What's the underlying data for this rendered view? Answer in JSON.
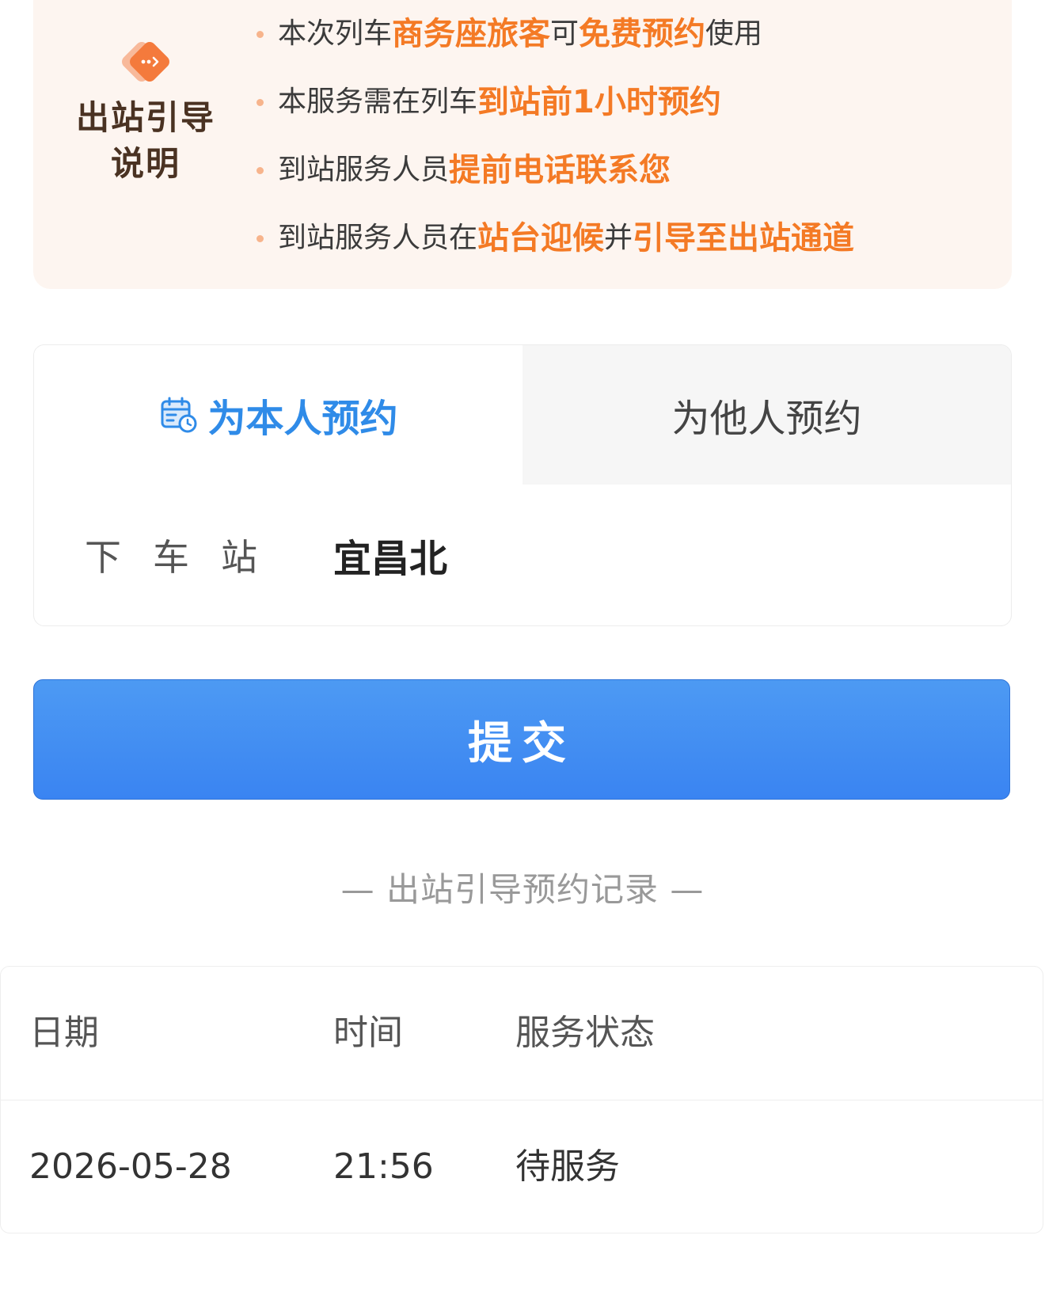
{
  "guide": {
    "title": "出站引导\n说明",
    "items": [
      {
        "parts": [
          "本次列车",
          "商务座旅客",
          "可",
          "免费预约",
          "使用"
        ]
      },
      {
        "parts": [
          "本服务需在列车",
          "到站前1小时预约"
        ]
      },
      {
        "parts": [
          "到站服务人员",
          "提前电话联系您"
        ]
      },
      {
        "parts": [
          "到站服务人员在",
          "站台迎候",
          "并",
          "引导至出站通道"
        ]
      }
    ]
  },
  "booking": {
    "tab_self": "为本人预约",
    "tab_other": "为他人预约",
    "station_label": "下车站",
    "station_value": "宜昌北"
  },
  "submit_label": "提交",
  "records": {
    "title": "— 出站引导预约记录 —",
    "headers": {
      "date": "日期",
      "time": "时间",
      "status": "服务状态"
    },
    "rows": [
      {
        "date": "2026-05-28",
        "time": "21:56",
        "status": "待服务"
      }
    ]
  },
  "colors": {
    "accent_orange": "#f47a25",
    "tab_active_blue": "#2f8be8",
    "button_blue": "#3a84f2"
  },
  "icons": {
    "guide_icon": "guide-diamond-icon",
    "tab_icon": "calendar-clock-icon"
  }
}
